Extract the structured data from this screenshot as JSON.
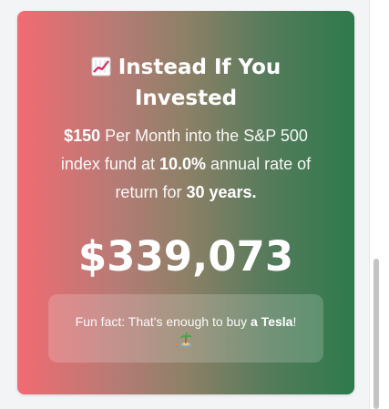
{
  "card": {
    "title_line1": "Instead If You",
    "title_line2": "Invested",
    "title_icon": "chart-increasing-icon",
    "monthly_amount": "$150",
    "desc_part1": " Per Month into the S&P 500 index fund at ",
    "rate": "10.0%",
    "desc_part2": " annual rate of return for ",
    "years": "30 years.",
    "result_amount": "$339,073",
    "fun_fact_prefix": "Fun fact: That's enough to buy ",
    "fun_fact_item": "a Tesla",
    "fun_fact_suffix": "!",
    "fun_fact_icon": "desert-island-icon"
  },
  "colors": {
    "gradient_start": "#f16b72",
    "gradient_end": "#2e7a4c",
    "text": "#ffffff"
  }
}
